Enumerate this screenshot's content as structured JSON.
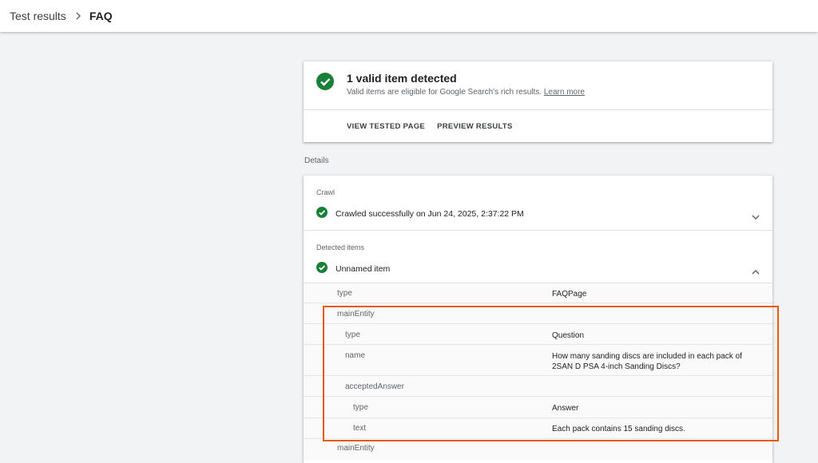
{
  "breadcrumb": {
    "parent": "Test results",
    "current": "FAQ"
  },
  "summary": {
    "title": "1 valid item detected",
    "subtitle": "Valid items are eligible for Google Search's rich results.",
    "learn_more": "Learn more",
    "actions": {
      "view_tested_page": "VIEW TESTED PAGE",
      "preview_results": "PREVIEW RESULTS"
    }
  },
  "details_label": "Details",
  "crawl": {
    "label": "Crawl",
    "status": "Crawled successfully on Jun 24, 2025, 2:37:22 PM"
  },
  "detected": {
    "label": "Detected items",
    "item": "Unnamed item"
  },
  "rows": [
    {
      "key": "type",
      "value": "FAQPage"
    },
    {
      "key": "mainEntity",
      "value": ""
    },
    {
      "key": "type",
      "value": "Question"
    },
    {
      "key": "name",
      "value": "How many sanding discs are included in each pack of 2SAN D PSA 4-inch Sanding Discs?"
    },
    {
      "key": "acceptedAnswer",
      "value": ""
    },
    {
      "key": "type",
      "value": "Answer"
    },
    {
      "key": "text",
      "value": "Each pack contains 15 sanding discs."
    },
    {
      "key": "mainEntity",
      "value": ""
    }
  ],
  "colors": {
    "success": "#188038",
    "highlight": "#e8590c"
  }
}
